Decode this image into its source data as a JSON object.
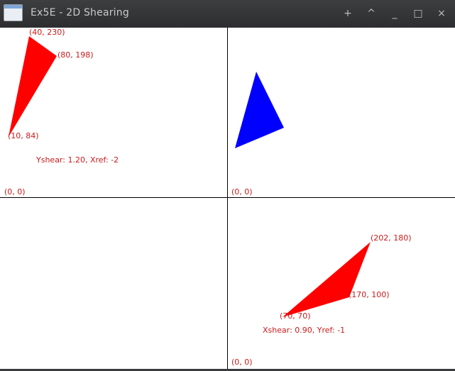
{
  "window": {
    "title": "Ex5E - 2D Shearing",
    "controls": [
      "+",
      "^",
      "_",
      "□",
      "×"
    ]
  },
  "panels": {
    "top_left": {
      "origin": "(0, 0)",
      "color": "#ff0000",
      "vertices": [
        "(40, 230)",
        "(80, 198)",
        "(10, 84)"
      ],
      "caption": "Yshear: 1.20, Xref: -2"
    },
    "top_right": {
      "origin": "(0, 0)",
      "color": "#0000ff"
    },
    "bottom_left": {},
    "bottom_right": {
      "origin": "(0, 0)",
      "color": "#ff0000",
      "vertices": [
        "(202, 180)",
        "(170, 100)",
        "(70, 70)"
      ],
      "caption": "Xshear: 0.90, Yref: -1"
    }
  }
}
